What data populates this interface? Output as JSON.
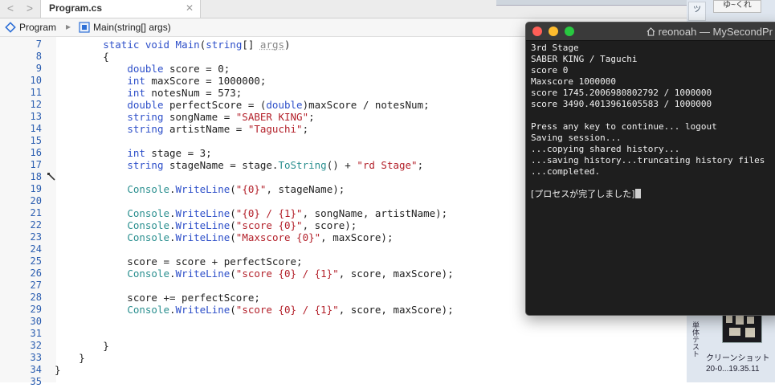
{
  "ide": {
    "tab_title": "Program.cs",
    "tab_close": "✕",
    "nav_back": "<",
    "nav_forward": ">",
    "breadcrumbs": [
      "Program",
      "Main(string[] args)"
    ],
    "breadcrumb_separator": "▸",
    "lines": [
      {
        "n": "7",
        "code": [
          {
            "t": "        "
          },
          {
            "c": "kw",
            "t": "static void"
          },
          {
            "t": " "
          },
          {
            "c": "meth",
            "t": "Main"
          },
          {
            "t": "("
          },
          {
            "c": "kw",
            "t": "string"
          },
          {
            "t": "[] "
          },
          {
            "c": "prm",
            "t": "args"
          },
          {
            "t": ")"
          }
        ]
      },
      {
        "n": "8",
        "code": [
          {
            "t": "        {"
          }
        ]
      },
      {
        "n": "9",
        "code": [
          {
            "t": "            "
          },
          {
            "c": "kw",
            "t": "double"
          },
          {
            "t": " score = 0;"
          }
        ]
      },
      {
        "n": "10",
        "code": [
          {
            "t": "            "
          },
          {
            "c": "kw",
            "t": "int"
          },
          {
            "t": " maxScore = 1000000;"
          }
        ]
      },
      {
        "n": "11",
        "code": [
          {
            "t": "            "
          },
          {
            "c": "kw",
            "t": "int"
          },
          {
            "t": " notesNum = 573;"
          }
        ]
      },
      {
        "n": "12",
        "code": [
          {
            "t": "            "
          },
          {
            "c": "kw",
            "t": "double"
          },
          {
            "t": " perfectScore = ("
          },
          {
            "c": "kw",
            "t": "double"
          },
          {
            "t": ")maxScore / notesNum;"
          }
        ]
      },
      {
        "n": "13",
        "code": [
          {
            "t": "            "
          },
          {
            "c": "kw",
            "t": "string"
          },
          {
            "t": " songName = "
          },
          {
            "c": "str",
            "t": "\"SABER KING\""
          },
          {
            "t": ";"
          }
        ]
      },
      {
        "n": "14",
        "code": [
          {
            "t": "            "
          },
          {
            "c": "kw",
            "t": "string"
          },
          {
            "t": " artistName = "
          },
          {
            "c": "str",
            "t": "\"Taguchi\""
          },
          {
            "t": ";"
          }
        ]
      },
      {
        "n": "15",
        "code": []
      },
      {
        "n": "16",
        "code": [
          {
            "t": "            "
          },
          {
            "c": "kw",
            "t": "int"
          },
          {
            "t": " stage = 3;"
          }
        ]
      },
      {
        "n": "17",
        "code": [
          {
            "t": "            "
          },
          {
            "c": "kw",
            "t": "string"
          },
          {
            "t": " stageName = stage."
          },
          {
            "c": "cls",
            "t": "ToString"
          },
          {
            "t": "() + "
          },
          {
            "c": "str",
            "t": "\"rd Stage\""
          },
          {
            "t": ";"
          }
        ]
      },
      {
        "n": "18",
        "code": []
      },
      {
        "n": "19",
        "code": [
          {
            "t": "            "
          },
          {
            "c": "cls",
            "t": "Console"
          },
          {
            "t": "."
          },
          {
            "c": "meth",
            "t": "WriteLine"
          },
          {
            "t": "("
          },
          {
            "c": "str",
            "t": "\"{0}\""
          },
          {
            "t": ", stageName);"
          }
        ]
      },
      {
        "n": "20",
        "code": []
      },
      {
        "n": "21",
        "code": [
          {
            "t": "            "
          },
          {
            "c": "cls",
            "t": "Console"
          },
          {
            "t": "."
          },
          {
            "c": "meth",
            "t": "WriteLine"
          },
          {
            "t": "("
          },
          {
            "c": "str",
            "t": "\"{0} / {1}\""
          },
          {
            "t": ", songName, artistName);"
          }
        ]
      },
      {
        "n": "22",
        "code": [
          {
            "t": "            "
          },
          {
            "c": "cls",
            "t": "Console"
          },
          {
            "t": "."
          },
          {
            "c": "meth",
            "t": "WriteLine"
          },
          {
            "t": "("
          },
          {
            "c": "str",
            "t": "\"score {0}\""
          },
          {
            "t": ", score);"
          }
        ]
      },
      {
        "n": "23",
        "code": [
          {
            "t": "            "
          },
          {
            "c": "cls",
            "t": "Console"
          },
          {
            "t": "."
          },
          {
            "c": "meth",
            "t": "WriteLine"
          },
          {
            "t": "("
          },
          {
            "c": "str",
            "t": "\"Maxscore {0}\""
          },
          {
            "t": ", maxScore);"
          }
        ]
      },
      {
        "n": "24",
        "code": []
      },
      {
        "n": "25",
        "code": [
          {
            "t": "            score = score + perfectScore;"
          }
        ]
      },
      {
        "n": "26",
        "code": [
          {
            "t": "            "
          },
          {
            "c": "cls",
            "t": "Console"
          },
          {
            "t": "."
          },
          {
            "c": "meth",
            "t": "WriteLine"
          },
          {
            "t": "("
          },
          {
            "c": "str",
            "t": "\"score {0} / {1}\""
          },
          {
            "t": ", score, maxScore);"
          }
        ]
      },
      {
        "n": "27",
        "code": []
      },
      {
        "n": "28",
        "code": [
          {
            "t": "            score += perfectScore;"
          }
        ]
      },
      {
        "n": "29",
        "code": [
          {
            "t": "            "
          },
          {
            "c": "cls",
            "t": "Console"
          },
          {
            "t": "."
          },
          {
            "c": "meth",
            "t": "WriteLine"
          },
          {
            "t": "("
          },
          {
            "c": "str",
            "t": "\"score {0} / {1}\""
          },
          {
            "t": ", score, maxScore);"
          }
        ]
      },
      {
        "n": "30",
        "code": []
      },
      {
        "n": "31",
        "code": []
      },
      {
        "n": "32",
        "code": [
          {
            "t": "        }"
          }
        ]
      },
      {
        "n": "33",
        "code": [
          {
            "t": "    }"
          }
        ]
      },
      {
        "n": "34",
        "code": [
          {
            "t": "}"
          }
        ]
      },
      {
        "n": "35",
        "code": []
      }
    ]
  },
  "terminal": {
    "title": "reonoah — MySecondPr",
    "lines": [
      "3rd Stage",
      "SABER KING / Taguchi",
      "score 0",
      "Maxscore 1000000",
      "score 1745.2006980802792 / 1000000",
      "score 3490.4013961605583 / 1000000",
      "",
      "Press any key to continue... logout",
      "Saving session...",
      "...copying shared history...",
      "...saving history...truncating history files",
      "...completed.",
      ""
    ],
    "final_line": "[プロセスが完了しました]"
  },
  "desktop": {
    "top_tag": "ゆ~くれ",
    "vertical_text": "単体テスト",
    "screenshot_label_1": "クリーンショット",
    "screenshot_label_2": "20-0...19.35.11",
    "side_icon": "ツ"
  },
  "colors": {
    "keyword": "#2d4fc9",
    "string": "#b3202a",
    "class": "#2a8f8f",
    "terminal_bg": "#1e1e1e"
  }
}
